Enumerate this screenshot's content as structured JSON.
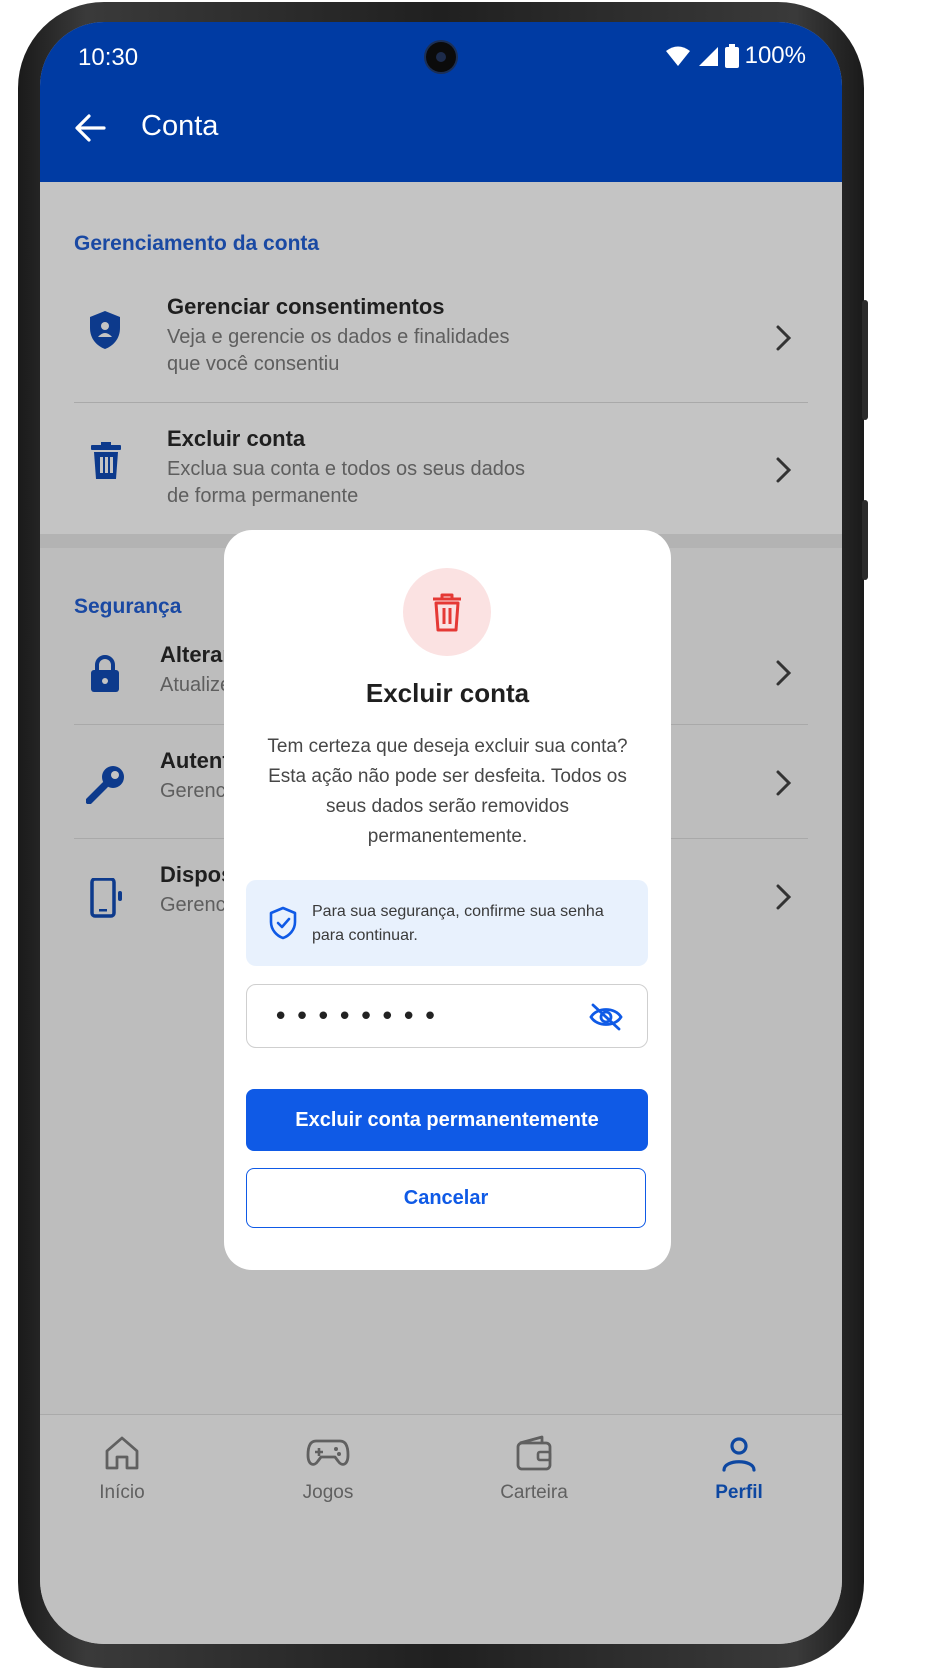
{
  "status_bar": {
    "time": "10:30",
    "battery": "100%"
  },
  "app_bar": {
    "title": "Conta"
  },
  "sections": [
    {
      "title": "Gerenciamento da conta",
      "items": [
        {
          "title": "Gerenciar consentimentos",
          "subtitle_line1": "Veja e gerencie os dados e finalidades",
          "subtitle_line2": "que você consentiu",
          "icon": "shield-icon"
        },
        {
          "title": "Excluir conta",
          "subtitle_line1": "Exclua sua conta e todos os seus dados",
          "subtitle_line2": "de forma permanente",
          "icon": "trash-icon"
        }
      ]
    },
    {
      "title": "Segurança",
      "items": [
        {
          "title": "Alterar",
          "subtitle": "Atualize",
          "icon": "lock-icon"
        },
        {
          "title": "Autent",
          "subtitle": "Gerenc",
          "icon": "key-icon"
        },
        {
          "title": "Dispos",
          "subtitle": "Gerenc",
          "icon": "device-icon"
        }
      ]
    }
  ],
  "dialog": {
    "title": "Excluir conta",
    "message": "Tem certeza que deseja excluir sua conta? Esta ação não pode ser desfeita. Todos os seus dados serão removidos permanentemente.",
    "notice": "Para sua segurança, confirme sua senha para continuar.",
    "password_value": "••••••••",
    "confirm_label": "Excluir conta permanentemente",
    "cancel_label": "Cancelar"
  },
  "bottom_nav": [
    {
      "label": "Início",
      "icon": "home-icon",
      "active": false
    },
    {
      "label": "Jogos",
      "icon": "gamepad-icon",
      "active": false
    },
    {
      "label": "Carteira",
      "icon": "wallet-icon",
      "active": false
    },
    {
      "label": "Perfil",
      "icon": "profile-icon",
      "active": true
    }
  ],
  "colors": {
    "primary": "#0f5ae6",
    "app_bar": "#003ba3",
    "danger": "#e53935",
    "danger_bg": "#fbe2e2"
  }
}
